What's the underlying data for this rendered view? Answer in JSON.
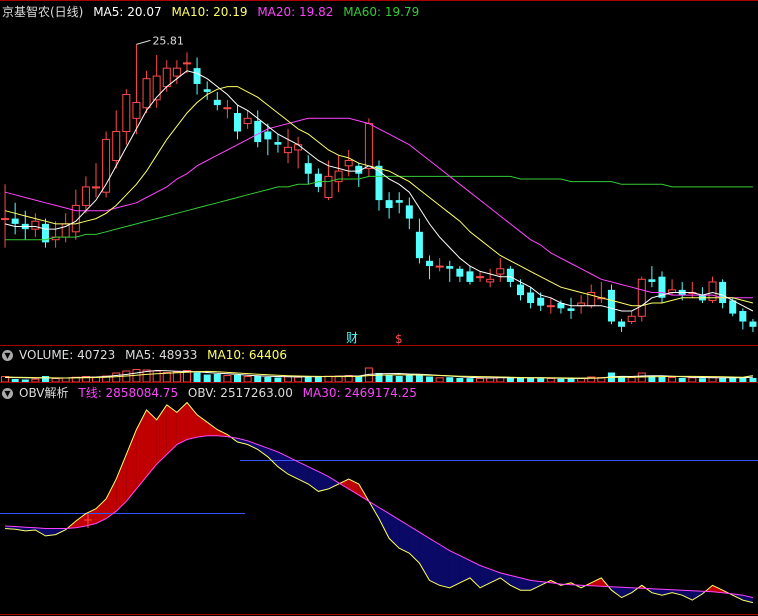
{
  "colors": {
    "bg": "#000000",
    "up": "#ff4a4a",
    "down": "#54ffff",
    "ma5": "#ffffff",
    "ma10": "#ffff66",
    "ma20": "#ff44ff",
    "ma60": "#33cc33",
    "grid": "#cc0000",
    "obv_fill_up": "#c00000",
    "obv_fill_down": "#0a0a66",
    "volma": "#ffff66",
    "blue": "#3355ff"
  },
  "main_header": {
    "title": "京基智农(日线)",
    "ma5": "MA5: 20.07",
    "ma10": "MA10: 20.19",
    "ma20": "MA20: 19.82",
    "ma60": "MA60: 19.79"
  },
  "vol_header": {
    "toggle_icon": "chevron-down-icon",
    "volume": "VOLUME: 40723",
    "ma5": "MA5: 48933",
    "ma10": "MA10: 64406"
  },
  "obv_header": {
    "toggle_icon": "chevron-down-icon",
    "title": "OBV解析",
    "tline": "T线: 2858084.75",
    "obv": "OBV: 2517263.00",
    "ma30": "MA30: 2469174.25"
  },
  "annotations": {
    "high_label": "25.81",
    "cai": "财",
    "dollar": "$"
  },
  "chart_data": [
    {
      "type": "candlestick",
      "name": "price",
      "ylim": [
        15.2,
        27.4
      ],
      "candles": [
        [
          19.8,
          19.8,
          21.1,
          18.7
        ],
        [
          19.8,
          19.6,
          20.4,
          19.2
        ],
        [
          19.6,
          19.4,
          20.1,
          19.0
        ],
        [
          19.4,
          19.7,
          20.0,
          19.1
        ],
        [
          19.6,
          18.9,
          19.8,
          18.7
        ],
        [
          19.0,
          19.1,
          19.7,
          18.7
        ],
        [
          19.1,
          19.6,
          20.0,
          18.9
        ],
        [
          19.3,
          20.3,
          20.9,
          19.0
        ],
        [
          20.3,
          21.0,
          21.4,
          20.0
        ],
        [
          21.0,
          21.0,
          21.9,
          20.6
        ],
        [
          20.8,
          22.8,
          23.1,
          20.6
        ],
        [
          22.0,
          23.1,
          23.9,
          21.7
        ],
        [
          23.1,
          24.5,
          24.7,
          22.6
        ],
        [
          23.6,
          24.2,
          26.4,
          23.0
        ],
        [
          24.0,
          25.1,
          25.4,
          23.8
        ],
        [
          24.3,
          25.2,
          26.0,
          24.0
        ],
        [
          24.8,
          25.5,
          25.8,
          24.6
        ],
        [
          25.2,
          25.5,
          25.8,
          24.9
        ],
        [
          25.7,
          25.7,
          26.1,
          25.3
        ],
        [
          25.5,
          24.9,
          25.9,
          24.5
        ],
        [
          24.7,
          24.6,
          25.0,
          24.3
        ],
        [
          24.3,
          24.1,
          24.6,
          23.9
        ],
        [
          24.0,
          24.0,
          24.3,
          23.6
        ],
        [
          23.8,
          23.1,
          24.1,
          22.8
        ],
        [
          23.4,
          23.6,
          23.9,
          23.2
        ],
        [
          23.5,
          22.7,
          23.9,
          22.5
        ],
        [
          23.1,
          22.8,
          23.4,
          22.2
        ],
        [
          22.7,
          22.6,
          23.0,
          22.3
        ],
        [
          22.3,
          22.5,
          23.2,
          21.9
        ],
        [
          22.4,
          22.6,
          22.9,
          21.7
        ],
        [
          21.9,
          21.5,
          22.2,
          21.1
        ],
        [
          21.5,
          21.0,
          21.7,
          20.8
        ],
        [
          20.6,
          21.4,
          22.0,
          20.5
        ],
        [
          21.2,
          21.6,
          22.2,
          20.8
        ],
        [
          21.8,
          22.0,
          22.4,
          21.4
        ],
        [
          21.8,
          21.5,
          21.9,
          21.0
        ],
        [
          21.7,
          23.4,
          23.6,
          21.4
        ],
        [
          21.8,
          20.5,
          22.0,
          20.1
        ],
        [
          20.5,
          20.2,
          20.8,
          19.8
        ],
        [
          20.5,
          20.4,
          20.8,
          20.0
        ],
        [
          20.3,
          19.8,
          20.6,
          19.4
        ],
        [
          19.3,
          18.3,
          19.8,
          18.1
        ],
        [
          18.2,
          18.0,
          18.4,
          17.5
        ],
        [
          18.0,
          18.0,
          18.3,
          17.8
        ],
        [
          18.0,
          17.9,
          18.2,
          17.4
        ],
        [
          17.9,
          17.6,
          18.0,
          17.4
        ],
        [
          17.8,
          17.4,
          18.0,
          17.3
        ],
        [
          17.6,
          17.6,
          17.8,
          17.4
        ],
        [
          17.4,
          17.5,
          17.9,
          17.2
        ],
        [
          17.7,
          17.9,
          18.3,
          17.4
        ],
        [
          17.9,
          17.4,
          18.0,
          17.2
        ],
        [
          17.3,
          16.9,
          17.5,
          16.7
        ],
        [
          17.0,
          16.6,
          17.2,
          16.4
        ],
        [
          16.8,
          16.5,
          17.0,
          16.3
        ],
        [
          16.5,
          16.5,
          16.8,
          16.2
        ],
        [
          16.6,
          16.4,
          16.7,
          16.2
        ],
        [
          16.4,
          16.3,
          16.8,
          16.0
        ],
        [
          16.5,
          16.6,
          16.9,
          16.2
        ],
        [
          16.5,
          17.0,
          17.3,
          16.4
        ],
        [
          16.8,
          16.8,
          17.4,
          16.6
        ],
        [
          17.1,
          15.9,
          17.3,
          15.8
        ],
        [
          15.9,
          15.7,
          16.0,
          15.5
        ],
        [
          15.9,
          16.1,
          16.3,
          15.8
        ],
        [
          16.1,
          17.5,
          17.6,
          15.9
        ],
        [
          17.5,
          17.4,
          18.0,
          17.2
        ],
        [
          17.6,
          16.8,
          17.8,
          16.6
        ],
        [
          17.0,
          17.1,
          17.5,
          16.9
        ],
        [
          17.1,
          16.9,
          17.4,
          16.7
        ],
        [
          17.0,
          17.0,
          17.4,
          16.8
        ],
        [
          16.9,
          16.7,
          17.2,
          16.6
        ],
        [
          16.7,
          17.4,
          17.6,
          16.6
        ],
        [
          17.4,
          16.6,
          17.5,
          16.4
        ],
        [
          16.7,
          16.2,
          16.8,
          16.1
        ],
        [
          16.3,
          15.9,
          16.4,
          15.6
        ],
        [
          15.9,
          15.7,
          16.0,
          15.5
        ]
      ],
      "ma5": [
        19.6,
        19.5,
        19.5,
        19.5,
        19.4,
        19.4,
        19.5,
        19.7,
        20.1,
        20.5,
        21.1,
        21.8,
        22.5,
        23.2,
        23.9,
        24.4,
        24.8,
        25.1,
        25.4,
        25.3,
        25.1,
        24.8,
        24.5,
        24.1,
        23.9,
        23.6,
        23.3,
        23.0,
        22.8,
        22.6,
        22.3,
        22.0,
        21.8,
        21.7,
        21.6,
        21.6,
        21.8,
        21.6,
        21.3,
        21.1,
        20.8,
        20.2,
        19.6,
        19.1,
        18.7,
        18.3,
        18.0,
        17.8,
        17.7,
        17.6,
        17.6,
        17.4,
        17.2,
        16.9,
        16.8,
        16.6,
        16.5,
        16.5,
        16.5,
        16.5,
        16.4,
        16.3,
        16.3,
        16.5,
        16.8,
        16.9,
        17.0,
        17.0,
        17.0,
        16.9,
        17.0,
        16.9,
        16.7,
        16.5,
        16.3
      ],
      "ma10": [
        20.1,
        20.0,
        19.9,
        19.8,
        19.7,
        19.6,
        19.6,
        19.6,
        19.7,
        19.8,
        20.0,
        20.3,
        20.7,
        21.1,
        21.6,
        22.2,
        22.8,
        23.3,
        23.8,
        24.2,
        24.5,
        24.7,
        24.8,
        24.8,
        24.6,
        24.4,
        24.1,
        23.8,
        23.5,
        23.2,
        23.0,
        22.7,
        22.4,
        22.2,
        22.1,
        21.9,
        21.8,
        21.7,
        21.6,
        21.4,
        21.2,
        20.9,
        20.6,
        20.3,
        20.0,
        19.7,
        19.3,
        19.0,
        18.7,
        18.4,
        18.2,
        18.0,
        17.8,
        17.6,
        17.4,
        17.2,
        17.1,
        17.0,
        16.9,
        16.8,
        16.7,
        16.6,
        16.5,
        16.5,
        16.6,
        16.6,
        16.7,
        16.8,
        16.8,
        16.8,
        16.8,
        16.8,
        16.8,
        16.7,
        16.6
      ],
      "ma20": [
        20.8,
        20.7,
        20.6,
        20.5,
        20.4,
        20.3,
        20.2,
        20.1,
        20.1,
        20.1,
        20.1,
        20.2,
        20.3,
        20.4,
        20.6,
        20.8,
        21.0,
        21.3,
        21.5,
        21.8,
        22.0,
        22.2,
        22.4,
        22.6,
        22.8,
        23.0,
        23.2,
        23.3,
        23.4,
        23.5,
        23.6,
        23.6,
        23.6,
        23.6,
        23.6,
        23.5,
        23.4,
        23.2,
        23.0,
        22.8,
        22.6,
        22.3,
        22.0,
        21.7,
        21.4,
        21.1,
        20.8,
        20.5,
        20.2,
        19.9,
        19.6,
        19.3,
        19.0,
        18.8,
        18.5,
        18.3,
        18.1,
        17.9,
        17.7,
        17.5,
        17.4,
        17.3,
        17.2,
        17.1,
        17.0,
        17.0,
        16.9,
        16.9,
        16.9,
        16.9,
        16.9,
        16.8,
        16.8,
        16.8,
        16.8
      ],
      "ma60": [
        19.0,
        19.0,
        19.0,
        19.0,
        19.0,
        19.1,
        19.1,
        19.1,
        19.2,
        19.2,
        19.3,
        19.4,
        19.5,
        19.6,
        19.7,
        19.8,
        19.9,
        20.0,
        20.1,
        20.2,
        20.3,
        20.4,
        20.5,
        20.6,
        20.7,
        20.8,
        20.9,
        21.0,
        21.0,
        21.1,
        21.1,
        21.2,
        21.2,
        21.3,
        21.3,
        21.3,
        21.4,
        21.4,
        21.4,
        21.4,
        21.4,
        21.4,
        21.4,
        21.4,
        21.4,
        21.4,
        21.4,
        21.4,
        21.4,
        21.4,
        21.4,
        21.3,
        21.3,
        21.3,
        21.3,
        21.3,
        21.2,
        21.2,
        21.2,
        21.2,
        21.2,
        21.1,
        21.1,
        21.1,
        21.1,
        21.1,
        21.0,
        21.0,
        21.0,
        21.0,
        21.0,
        21.0,
        21.0,
        21.0,
        21.0
      ]
    },
    {
      "type": "bar",
      "name": "volume",
      "ylim": [
        0,
        200000
      ],
      "values": [
        55000,
        30000,
        25000,
        28000,
        60000,
        35000,
        40000,
        48000,
        55000,
        50000,
        60000,
        90000,
        110000,
        125000,
        120000,
        110000,
        95000,
        100000,
        115000,
        95000,
        75000,
        80000,
        65000,
        70000,
        55000,
        60000,
        50000,
        45000,
        55000,
        48000,
        60000,
        55000,
        58000,
        60000,
        65000,
        55000,
        140000,
        90000,
        70000,
        60000,
        68000,
        80000,
        55000,
        42000,
        48000,
        40000,
        38000,
        36000,
        42000,
        50000,
        45000,
        40000,
        42000,
        38000,
        35000,
        32000,
        35000,
        38000,
        50000,
        45000,
        95000,
        55000,
        45000,
        90000,
        60000,
        50000,
        45000,
        40000,
        42000,
        38000,
        50000,
        45000,
        40000,
        45000,
        40723
      ],
      "ma5": [
        45000,
        44000,
        42000,
        40000,
        42000,
        38000,
        40000,
        45000,
        48000,
        50000,
        55000,
        65000,
        75000,
        90000,
        105000,
        115000,
        112000,
        108000,
        105000,
        102000,
        95000,
        88000,
        82000,
        76000,
        68000,
        62000,
        58000,
        55000,
        52000,
        51000,
        53000,
        54000,
        55000,
        57000,
        60000,
        60000,
        76000,
        82000,
        84000,
        85000,
        80000,
        78000,
        72000,
        65000,
        60000,
        52000,
        46000,
        42000,
        40000,
        42000,
        43000,
        42000,
        43000,
        42000,
        40000,
        37000,
        36000,
        35000,
        38000,
        40000,
        52000,
        56000,
        55000,
        60000,
        62000,
        62000,
        58000,
        52000,
        48000,
        45000,
        43000,
        43000,
        43000,
        43000,
        48933
      ],
      "ma10": [
        50000,
        48000,
        46000,
        44000,
        43000,
        41000,
        40000,
        41000,
        43000,
        45000,
        48000,
        53000,
        60000,
        68000,
        76000,
        82000,
        87000,
        92000,
        98000,
        104000,
        106000,
        102000,
        96000,
        90000,
        84000,
        78000,
        72000,
        67000,
        63000,
        60000,
        58000,
        56000,
        55000,
        54000,
        55000,
        56000,
        64000,
        68000,
        70000,
        72000,
        70000,
        70000,
        68000,
        66000,
        62000,
        58000,
        56000,
        54000,
        52000,
        50000,
        48000,
        45000,
        43000,
        42000,
        42000,
        41000,
        40000,
        39000,
        40000,
        41000,
        46000,
        48000,
        48000,
        50000,
        52000,
        54000,
        56000,
        56000,
        56000,
        55000,
        54000,
        52000,
        50000,
        48000,
        64406
      ]
    },
    {
      "type": "area",
      "name": "obv",
      "ylim": [
        -5600000,
        2900000
      ],
      "t_line": 2858084.75,
      "obv": [
        -2300000,
        -2330000,
        -2400000,
        -2360000,
        -2600000,
        -2550000,
        -2350000,
        -2000000,
        -1700000,
        -1500000,
        -1100000,
        -300000,
        700000,
        1700000,
        2500000,
        2100000,
        2700000,
        2400000,
        2800000,
        2300000,
        2000000,
        1700000,
        1500000,
        1200000,
        1100000,
        900000,
        600000,
        200000,
        -100000,
        -300000,
        -500000,
        -800000,
        -700000,
        -500000,
        -300000,
        -500000,
        -1200000,
        -1900000,
        -2700000,
        -3100000,
        -3300000,
        -3700000,
        -4400000,
        -4600000,
        -4700000,
        -4500000,
        -4300000,
        -4700000,
        -4500000,
        -4300000,
        -4600000,
        -4800000,
        -4800000,
        -4600000,
        -4400000,
        -4600000,
        -4500000,
        -4700000,
        -4500000,
        -4300000,
        -4800000,
        -5100000,
        -4900000,
        -4600000,
        -4900000,
        -5000000,
        -4900000,
        -5000000,
        -5200000,
        -4950000,
        -4600000,
        -4800000,
        -5000000,
        -5200000,
        -5300000
      ],
      "ma30": [
        -2200000,
        -2220000,
        -2250000,
        -2270000,
        -2300000,
        -2300000,
        -2300000,
        -2270000,
        -2200000,
        -2100000,
        -1900000,
        -1600000,
        -1200000,
        -700000,
        -200000,
        300000,
        700000,
        1100000,
        1300000,
        1400000,
        1450000,
        1450000,
        1420000,
        1350000,
        1250000,
        1100000,
        950000,
        800000,
        600000,
        400000,
        200000,
        0,
        -200000,
        -450000,
        -700000,
        -950000,
        -1200000,
        -1450000,
        -1700000,
        -1950000,
        -2200000,
        -2450000,
        -2700000,
        -2950000,
        -3200000,
        -3400000,
        -3600000,
        -3800000,
        -3950000,
        -4100000,
        -4200000,
        -4300000,
        -4400000,
        -4450000,
        -4500000,
        -4550000,
        -4580000,
        -4600000,
        -4620000,
        -4640000,
        -4660000,
        -4680000,
        -4700000,
        -4720000,
        -4740000,
        -4760000,
        -4780000,
        -4800000,
        -4820000,
        -4840000,
        -4860000,
        -4900000,
        -4950000,
        -5000000,
        -5100000
      ]
    }
  ]
}
